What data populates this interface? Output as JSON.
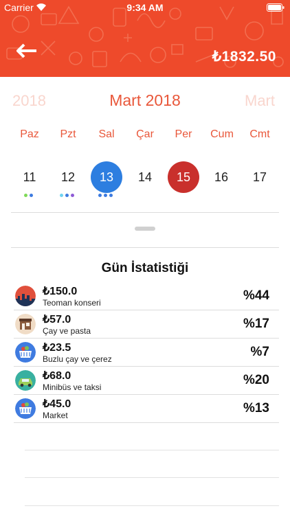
{
  "status_bar": {
    "carrier": "Carrier",
    "time": "9:34 AM"
  },
  "header": {
    "balance": "₺1832.50",
    "background_color": "#ee4a2b"
  },
  "month_selector": {
    "previous": "2018",
    "current": "Mart 2018",
    "next": "Mart"
  },
  "weekdays": [
    "Paz",
    "Pzt",
    "Sal",
    "Çar",
    "Per",
    "Cum",
    "Cmt"
  ],
  "days": [
    {
      "label": "11",
      "state": "normal",
      "dots": [
        "#7ed957",
        "#3d7be0"
      ]
    },
    {
      "label": "12",
      "state": "normal",
      "dots": [
        "#6fd3f0",
        "#3d7be0",
        "#8e5ad6"
      ]
    },
    {
      "label": "13",
      "state": "selected",
      "dots": [
        "#3d7be0",
        "#3d7be0",
        "#3d7be0"
      ]
    },
    {
      "label": "14",
      "state": "normal",
      "dots": []
    },
    {
      "label": "15",
      "state": "today",
      "dots": []
    },
    {
      "label": "16",
      "state": "normal",
      "dots": []
    },
    {
      "label": "17",
      "state": "normal",
      "dots": []
    }
  ],
  "colors": {
    "accent": "#e9573a",
    "selected_day": "#2d7ee0",
    "today": "#c9302c"
  },
  "stats": {
    "title": "Gün İstatistiği",
    "items": [
      {
        "amount": "₺150.0",
        "name": "Teoman konseri",
        "percent": "%44",
        "icon": "city-skyline-icon"
      },
      {
        "amount": "₺57.0",
        "name": "Çay ve pasta",
        "percent": "%17",
        "icon": "cafe-shop-icon"
      },
      {
        "amount": "₺23.5",
        "name": "Buzlu çay ve çerez",
        "percent": "%7",
        "icon": "shopping-basket-icon"
      },
      {
        "amount": "₺68.0",
        "name": "Minibüs ve taksi",
        "percent": "%20",
        "icon": "car-icon"
      },
      {
        "amount": "₺45.0",
        "name": "Market",
        "percent": "%13",
        "icon": "shopping-basket-icon"
      }
    ]
  }
}
